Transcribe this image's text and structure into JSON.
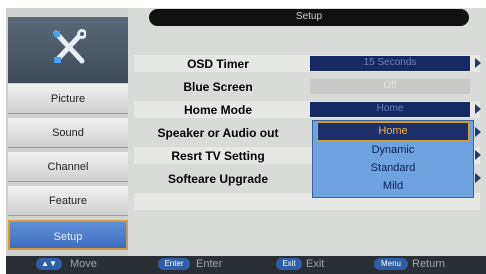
{
  "header": {
    "title": "Setup"
  },
  "sidebar": {
    "items": [
      {
        "label": "Picture"
      },
      {
        "label": "Sound"
      },
      {
        "label": "Channel"
      },
      {
        "label": "Feature"
      },
      {
        "label": "Setup"
      }
    ]
  },
  "settings": {
    "rows": [
      {
        "label": "OSD Timer",
        "value": "15 Seconds"
      },
      {
        "label": "Blue Screen",
        "value": "Off"
      },
      {
        "label": "Home Mode",
        "value": "Home"
      },
      {
        "label": "Speaker or Audio out"
      },
      {
        "label": "Resrt TV Setting"
      },
      {
        "label": "Softeare Upgrade"
      }
    ]
  },
  "dropdown": {
    "options": [
      "Home",
      "Dynamic",
      "Standard",
      "Mild"
    ],
    "selected": "Home"
  },
  "footer": {
    "move_key": "▲▼",
    "move_label": "Move",
    "enter_key": "Enter",
    "enter_label": "Enter",
    "exit_key": "Exit",
    "exit_label": "Exit",
    "menu_key": "Menu",
    "menu_label": "Return"
  },
  "icons": {
    "header": "tools-icon"
  },
  "colors": {
    "accent": "#3f6ec0",
    "value_box": "#152a64",
    "selected_border": "#d59b3a",
    "dropdown_bg": "#6fa3e0"
  }
}
